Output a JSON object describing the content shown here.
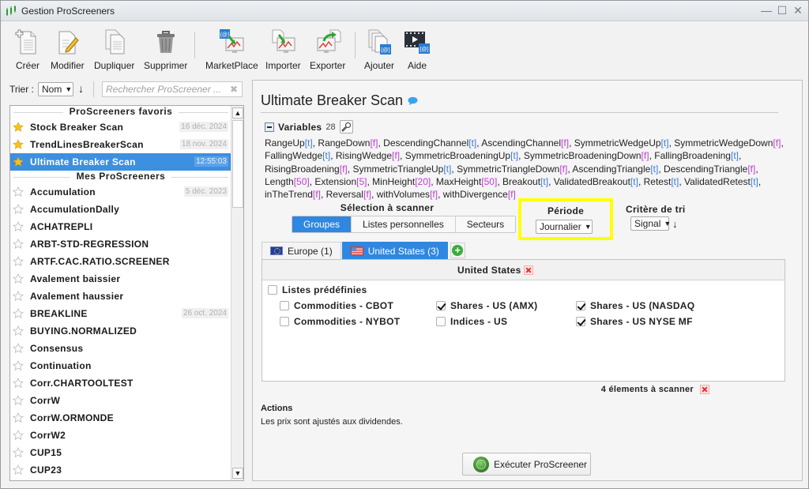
{
  "window": {
    "title": "Gestion ProScreeners",
    "controls": {
      "minimize": "—",
      "maximize": "☐",
      "close": "✕"
    }
  },
  "toolbar": {
    "buttons": [
      {
        "id": "creer",
        "label": "Créer",
        "icon": "new-document-icon"
      },
      {
        "id": "modifier",
        "label": "Modifier",
        "icon": "edit-document-icon"
      },
      {
        "id": "dupliquer",
        "label": "Dupliquer",
        "icon": "duplicate-icon"
      },
      {
        "id": "supprimer",
        "label": "Supprimer",
        "icon": "trash-icon"
      },
      {
        "id": "marketplace",
        "label": "MarketPlace",
        "icon": "marketplace-icon"
      },
      {
        "id": "importer",
        "label": "Importer",
        "icon": "import-icon"
      },
      {
        "id": "exporter",
        "label": "Exporter",
        "icon": "export-icon"
      },
      {
        "id": "ajouter",
        "label": "Ajouter",
        "icon": "add-library-icon"
      },
      {
        "id": "aide",
        "label": "Aide",
        "icon": "video-help-icon"
      }
    ]
  },
  "sort": {
    "label": "Trier :",
    "selected": "Nom",
    "direction_icon": "↓",
    "search_placeholder": "Rechercher ProScreener ...",
    "search_value": ""
  },
  "list": {
    "favorites_header": "ProScreeners favoris",
    "favorites": [
      {
        "name": "Stock Breaker Scan",
        "date": "16 déc. 2024",
        "starred": true,
        "selected": false
      },
      {
        "name": "TrendLinesBreakerScan",
        "date": "18 nov. 2024",
        "starred": true,
        "selected": false
      },
      {
        "name": "Ultimate Breaker Scan",
        "date": "12:55:03",
        "starred": true,
        "selected": true
      }
    ],
    "mine_header": "Mes ProScreeners",
    "mine": [
      {
        "name": "Accumulation",
        "date": "5 déc. 2023"
      },
      {
        "name": "AccumulationDally",
        "date": ""
      },
      {
        "name": "ACHATREPLI",
        "date": ""
      },
      {
        "name": "ARBT-STD-REGRESSION",
        "date": ""
      },
      {
        "name": "ARTF.CAC.RATIO.SCREENER",
        "date": ""
      },
      {
        "name": "Avalement baissier",
        "date": ""
      },
      {
        "name": "Avalement haussier",
        "date": ""
      },
      {
        "name": "BREAKLINE",
        "date": "26 oct. 2024"
      },
      {
        "name": "BUYING.NORMALIZED",
        "date": ""
      },
      {
        "name": "Consensus",
        "date": ""
      },
      {
        "name": "Continuation",
        "date": ""
      },
      {
        "name": "Corr.CHARTOOLTEST",
        "date": ""
      },
      {
        "name": "CorrW",
        "date": ""
      },
      {
        "name": "CorrW.ORMONDE",
        "date": ""
      },
      {
        "name": "CorrW2",
        "date": ""
      },
      {
        "name": "CUP15",
        "date": ""
      },
      {
        "name": "CUP23",
        "date": ""
      }
    ]
  },
  "main": {
    "title": "Ultimate Breaker Scan",
    "variables_label": "Variables",
    "variables_count": "28",
    "variables": [
      {
        "name": "RangeUp",
        "value": "t"
      },
      {
        "name": "RangeDown",
        "value": "f"
      },
      {
        "name": "DescendingChannel",
        "value": "t"
      },
      {
        "name": "AscendingChannel",
        "value": "f"
      },
      {
        "name": "SymmetricWedgeUp",
        "value": "t"
      },
      {
        "name": "SymmetricWedgeDown",
        "value": "f"
      },
      {
        "name": "FallingWedge",
        "value": "t"
      },
      {
        "name": "RisingWedge",
        "value": "f"
      },
      {
        "name": "SymmetricBroadeningUp",
        "value": "t"
      },
      {
        "name": "SymmetricBroadeningDown",
        "value": "f"
      },
      {
        "name": "FallingBroadening",
        "value": "t"
      },
      {
        "name": "RisingBroadening",
        "value": "f"
      },
      {
        "name": "SymmetricTriangleUp",
        "value": "t"
      },
      {
        "name": "SymmetricTriangleDown",
        "value": "f"
      },
      {
        "name": "AscendingTriangle",
        "value": "t"
      },
      {
        "name": "DescendingTriangle",
        "value": "f"
      },
      {
        "name": "Length",
        "value": "50"
      },
      {
        "name": "Extension",
        "value": "5"
      },
      {
        "name": "MinHeight",
        "value": "20"
      },
      {
        "name": "MaxHeight",
        "value": "50"
      },
      {
        "name": "Breakout",
        "value": "t"
      },
      {
        "name": "ValidatedBreakout",
        "value": "t"
      },
      {
        "name": "Retest",
        "value": "t"
      },
      {
        "name": "ValidatedRetest",
        "value": "t"
      },
      {
        "name": "inTheTrend",
        "value": "f"
      },
      {
        "name": "Reversal",
        "value": "f"
      },
      {
        "name": "withVolumes",
        "value": "f"
      },
      {
        "name": "withDivergence",
        "value": "f"
      }
    ],
    "selection_title": "Sélection à scanner",
    "selection_tabs": [
      {
        "label": "Groupes",
        "active": true
      },
      {
        "label": "Listes personnelles",
        "active": false
      },
      {
        "label": "Secteurs",
        "active": false
      }
    ],
    "periode_label": "Période",
    "periode_value": "Journalier",
    "critere_label": "Critère de tri",
    "critere_value": "Signal",
    "critere_direction": "↓",
    "highlight_color": "#ffff00",
    "region_tabs": [
      {
        "label": "Europe (1)",
        "flag": "eu-flag-icon",
        "active": false
      },
      {
        "label": "United States (3)",
        "flag": "us-flag-icon",
        "active": true
      }
    ],
    "scan_panel": {
      "country": "United States",
      "predefined_label": "Listes prédéfinies",
      "predefined_checked": false,
      "lists": [
        {
          "label": "Commodities - CBOT",
          "checked": false
        },
        {
          "label": "Shares - US (AMX)",
          "checked": true
        },
        {
          "label": "Shares - US (NASDAQ",
          "checked": true
        },
        {
          "label": "Commodities - NYBOT",
          "checked": false
        },
        {
          "label": "Indices - US",
          "checked": false
        },
        {
          "label": "Shares - US NYSE MF",
          "checked": true
        }
      ]
    },
    "elements_to_scan": "4 élements à scanner",
    "actions_title": "Actions",
    "actions_text": "Les prix sont ajustés aux dividendes.",
    "run_button": "Exécuter ProScreener"
  },
  "colors": {
    "accent": "#2f87e0",
    "selected_row": "#3d8fe0",
    "true_value": "#3b7ddd",
    "other_value": "#c03cd6"
  }
}
